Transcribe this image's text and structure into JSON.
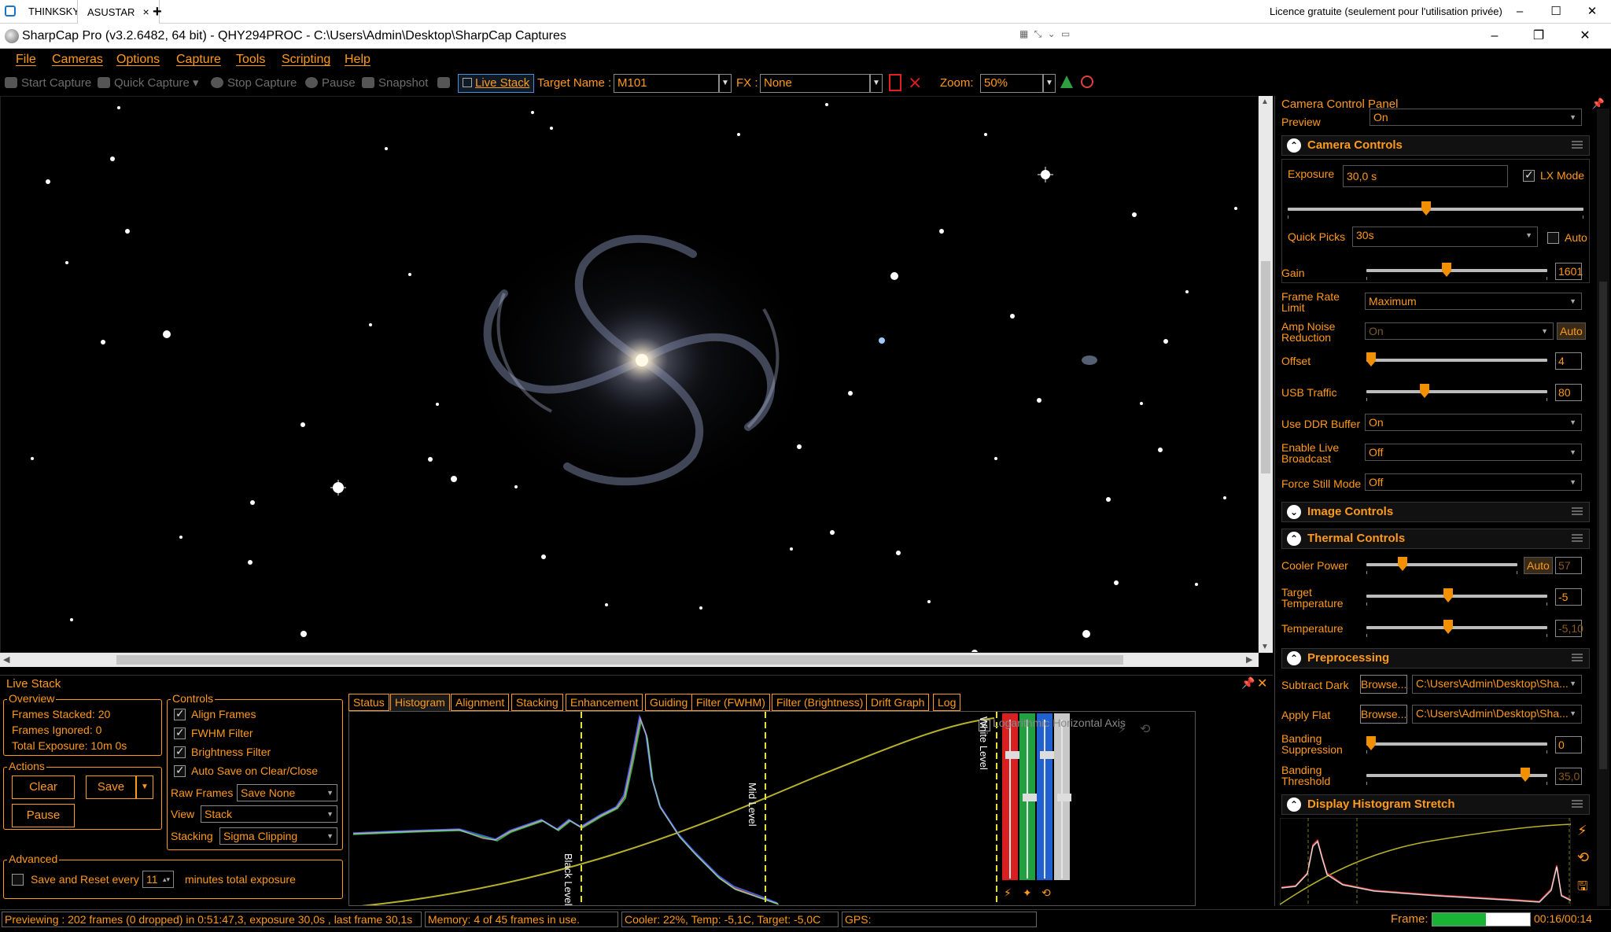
{
  "remote": {
    "tabs": [
      {
        "label": "THINKSKY"
      },
      {
        "label": "ASUSTAR",
        "close": "×"
      }
    ],
    "new_tab": "+",
    "licence": "Licence gratuite (seulement pour l'utilisation privée)",
    "controls": {
      "minimize": "–",
      "maximize": "☐",
      "close": "✕"
    }
  },
  "app": {
    "title": "SharpCap Pro (v3.2.6482, 64 bit) - QHY294PROC - C:\\Users\\Admin\\Desktop\\SharpCap Captures",
    "controls": {
      "minimize": "–",
      "restore": "❐",
      "close": "✕"
    }
  },
  "menu": [
    "File",
    "Cameras",
    "Options",
    "Capture",
    "Tools",
    "Scripting",
    "Help"
  ],
  "toolbar": {
    "start_capture": "Start Capture",
    "quick_capture": "Quick Capture",
    "stop_capture": "Stop Capture",
    "pause": "Pause",
    "snapshot": "Snapshot",
    "live_stack": "Live Stack",
    "target_name_label": "Target Name :",
    "target_name_value": "M101",
    "fx_label": "FX :",
    "fx_value": "None",
    "zoom_label": "Zoom:",
    "zoom_value": "50%"
  },
  "live_stack": {
    "title": "Live Stack",
    "overview": {
      "label": "Overview",
      "frames_stacked": "Frames Stacked: 20",
      "frames_ignored": "Frames Ignored:  0",
      "total_exposure": "Total Exposure:   10m 0s"
    },
    "actions": {
      "label": "Actions",
      "clear": "Clear",
      "save": "Save",
      "pause": "Pause"
    },
    "advanced": {
      "label": "Advanced",
      "save_reset": "Save and Reset every",
      "minutes_value": "11",
      "minutes_label": "minutes total exposure"
    },
    "controls": {
      "label": "Controls",
      "align_frames": "Align Frames",
      "fwhm_filter": "FWHM Filter",
      "brightness_filter": "Brightness Filter",
      "auto_save": "Auto Save on Clear/Close",
      "raw_frames_label": "Raw Frames",
      "raw_frames_value": "Save None",
      "view_label": "View",
      "view_value": "Stack",
      "stacking_label": "Stacking",
      "stacking_value": "Sigma Clipping"
    },
    "tabs": [
      "Status",
      "Histogram",
      "Alignment",
      "Stacking",
      "Enhancement",
      "Guiding",
      "Filter (FWHM)",
      "Filter (Brightness)",
      "Drift Graph",
      "Log"
    ],
    "active_tab": "Histogram",
    "histogram": {
      "log_axis": "Logarithmic Horizontal Axis",
      "black_level": "Black Level",
      "mid_level": "Mid Level",
      "white_level": "White Level"
    }
  },
  "status": {
    "previewing": "Previewing : 202 frames (0 dropped) in 0:51:47,3, exposure 30,0s , last frame 30,1s",
    "memory": "Memory: 4 of 45 frames in use.",
    "cooler": "Cooler: 22%, Temp: -5,1C, Target: -5,0C",
    "gps": "GPS:",
    "frame_label": "Frame:",
    "frame_progress": 0.55,
    "time": "00:16/00:14"
  },
  "panel": {
    "title": "Camera Control Panel",
    "preview_label": "Preview",
    "preview_value": "On",
    "camera_controls": "Camera Controls",
    "exposure_label": "Exposure",
    "exposure_value": "30,0 s",
    "lx_mode": "LX Mode",
    "quick_picks_label": "Quick Picks",
    "quick_picks_value": "30s",
    "auto": "Auto",
    "gain_label": "Gain",
    "gain_value": "1601",
    "frame_rate_label": "Frame Rate Limit",
    "frame_rate_value": "Maximum",
    "amp_noise_label": "Amp Noise Reduction",
    "amp_noise_value": "On",
    "amp_noise_auto": "Auto",
    "offset_label": "Offset",
    "offset_value": "4",
    "usb_label": "USB Traffic",
    "usb_value": "80",
    "ddr_label": "Use DDR Buffer",
    "ddr_value": "On",
    "broadcast_label": "Enable Live Broadcast",
    "broadcast_value": "Off",
    "force_still_label": "Force Still Mode",
    "force_still_value": "Off",
    "image_controls": "Image Controls",
    "thermal_controls": "Thermal Controls",
    "cooler_power_label": "Cooler Power",
    "cooler_power_auto": "Auto",
    "cooler_power_value": "57",
    "target_temp_label": "Target Temperature",
    "target_temp_value": "-5",
    "temperature_label": "Temperature",
    "temperature_value": "-5,10",
    "preprocessing": "Preprocessing",
    "subtract_dark_label": "Subtract Dark",
    "browse": "Browse...",
    "dark_path": "C:\\Users\\Admin\\Desktop\\Sha...",
    "apply_flat_label": "Apply Flat",
    "flat_path": "C:\\Users\\Admin\\Desktop\\Sha...",
    "banding_supp_label": "Banding Suppression",
    "banding_supp_value": "0",
    "banding_thr_label": "Banding Threshold",
    "banding_thr_value": "35,0",
    "display_histogram": "Display Histogram Stretch"
  },
  "colors": {
    "accent": "#ff9a1a",
    "background": "#000000",
    "knob": "#f29000",
    "frame_bar": "#19b436"
  }
}
